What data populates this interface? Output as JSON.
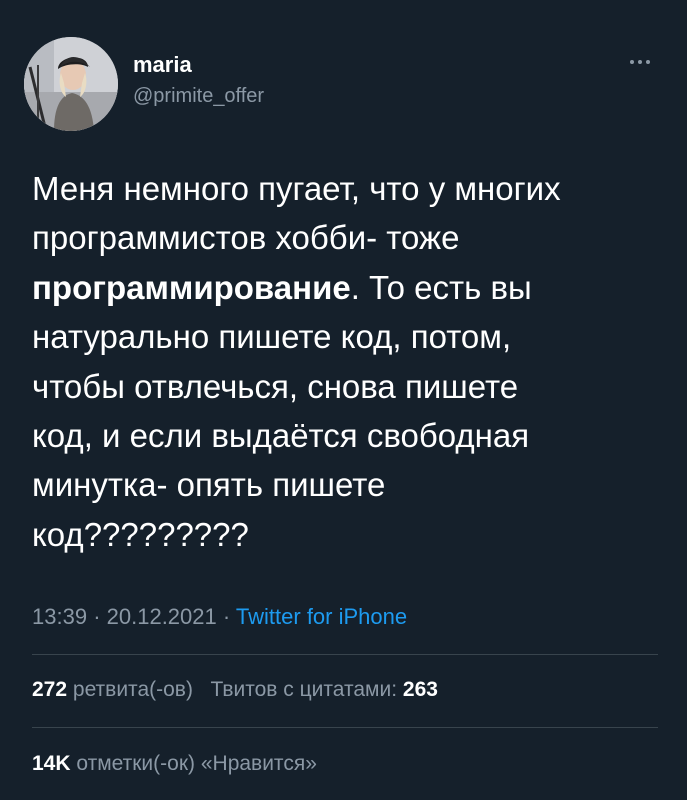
{
  "user": {
    "display_name": "maria",
    "handle": "@primite_offer"
  },
  "tweet": {
    "lines": [
      [
        "Меня немного пугает, что у многих",
        "",
        ""
      ],
      [
        "программистов хобби- тоже",
        "",
        ""
      ],
      [
        "",
        "программирование",
        ". То есть вы"
      ],
      [
        "натурально пишете код, потом,",
        "",
        ""
      ],
      [
        "чтобы отвлечься, снова пишете",
        "",
        ""
      ],
      [
        "код, и если выдаётся свободная",
        "",
        ""
      ],
      [
        "минутка- опять пишете",
        "",
        ""
      ],
      [
        "код?????????",
        "",
        ""
      ]
    ]
  },
  "meta": {
    "time": "13:39",
    "separator": "·",
    "date": "20.12.2021",
    "source": "Twitter for iPhone"
  },
  "stats": {
    "retweets_count": "272",
    "retweets_label": "ретвита(-ов)",
    "quotes_label": "Твитов с цитатами:",
    "quotes_count": "263",
    "likes_count": "14K",
    "likes_label": "отметки(-ок) «Нравится»"
  },
  "icons": {
    "more": "more-horizontal-icon"
  },
  "colors": {
    "background": "#15202b",
    "text": "#ffffff",
    "secondary": "#8b98a5",
    "link": "#1d9bf0",
    "divider": "#38444d"
  }
}
